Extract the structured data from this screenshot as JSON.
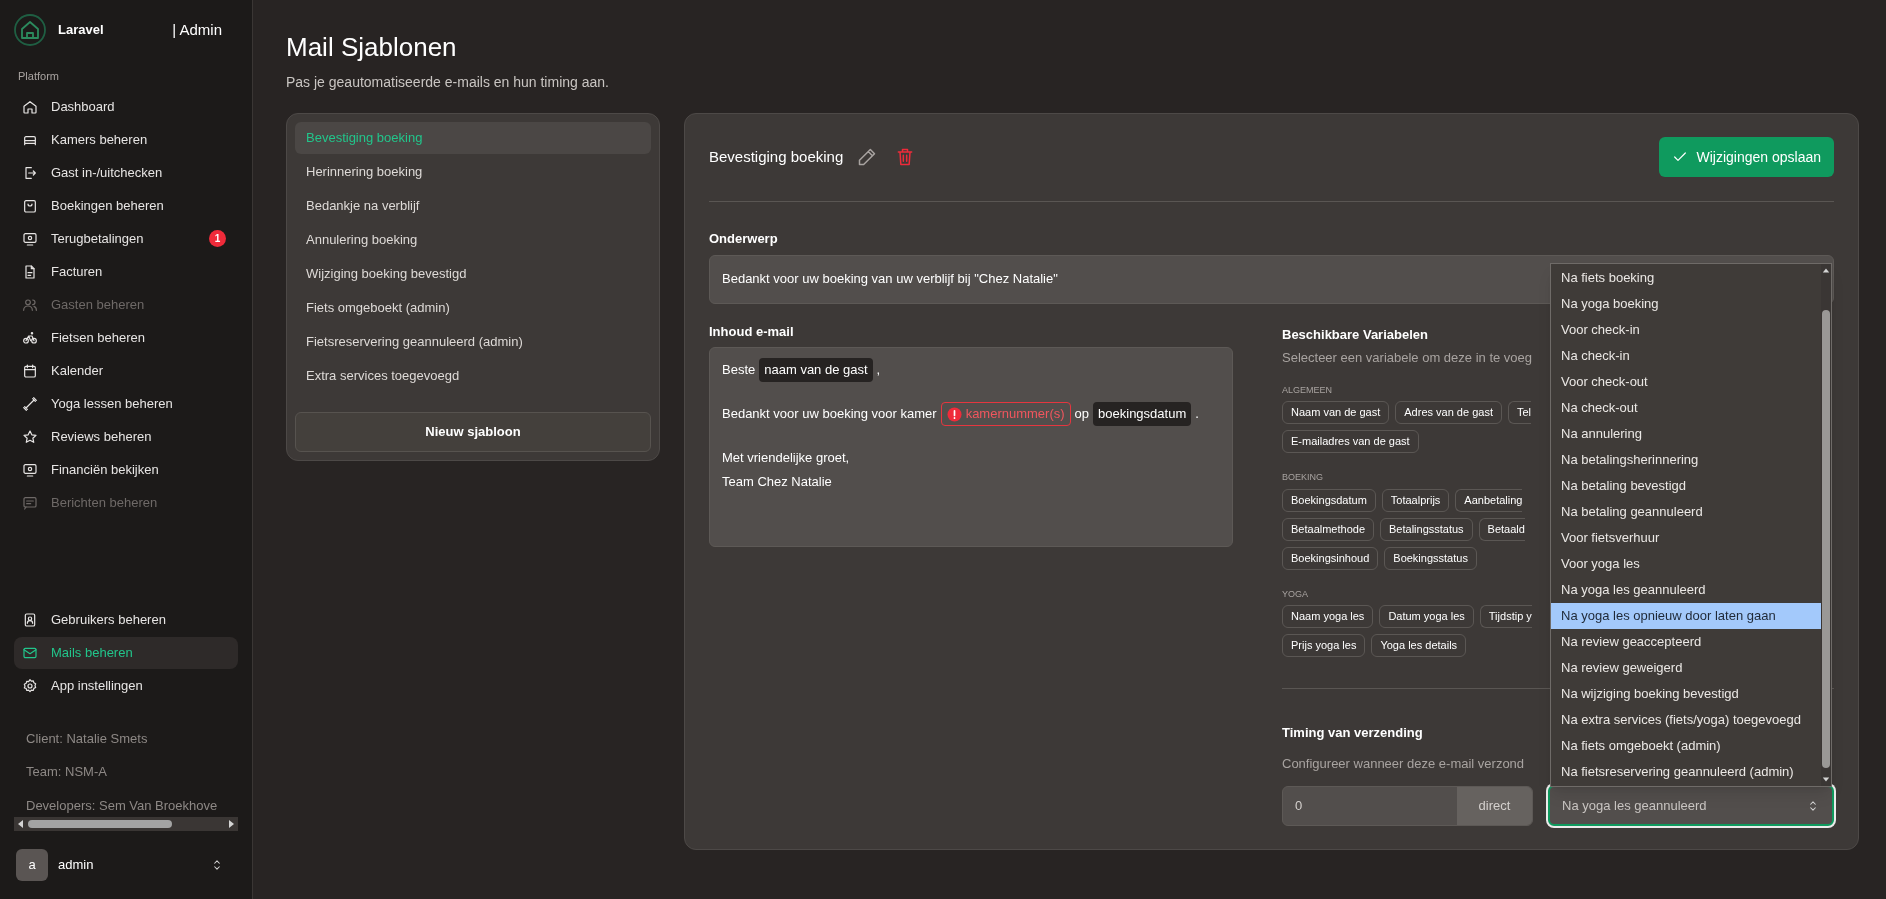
{
  "sidebar": {
    "brand": "Laravel",
    "brand_suffix": "| Admin",
    "section": "Platform",
    "items": [
      {
        "label": "Dashboard",
        "selected": false,
        "disabled": false
      },
      {
        "label": "Kamers beheren",
        "selected": false,
        "disabled": false
      },
      {
        "label": "Gast in-/uitchecken",
        "selected": false,
        "disabled": false
      },
      {
        "label": "Boekingen beheren",
        "selected": false,
        "disabled": false
      },
      {
        "label": "Terugbetalingen",
        "selected": false,
        "disabled": false,
        "badge": "1"
      },
      {
        "label": "Facturen",
        "selected": false,
        "disabled": false
      },
      {
        "label": "Gasten beheren",
        "selected": false,
        "disabled": true
      },
      {
        "label": "Fietsen beheren",
        "selected": false,
        "disabled": false
      },
      {
        "label": "Kalender",
        "selected": false,
        "disabled": false
      },
      {
        "label": "Yoga lessen beheren",
        "selected": false,
        "disabled": false
      },
      {
        "label": "Reviews beheren",
        "selected": false,
        "disabled": false
      },
      {
        "label": "Financiën bekijken",
        "selected": false,
        "disabled": false
      },
      {
        "label": "Berichten beheren",
        "selected": false,
        "disabled": true
      }
    ],
    "bottom_items": [
      {
        "label": "Gebruikers beheren",
        "selected": false,
        "disabled": false
      },
      {
        "label": "Mails beheren",
        "selected": true,
        "disabled": false
      },
      {
        "label": "App instellingen",
        "selected": false,
        "disabled": false
      }
    ],
    "info": [
      "Client: Natalie Smets",
      "Team: NSM-A",
      "Developers: Sem Van Broekhove"
    ],
    "user": {
      "avatar": "a",
      "name": "admin"
    }
  },
  "page": {
    "title": "Mail Sjablonen",
    "subtitle": "Pas je geautomatiseerde e-mails en hun timing aan."
  },
  "templates": {
    "items": [
      {
        "label": "Bevestiging boeking",
        "selected": true
      },
      {
        "label": "Herinnering boeking",
        "selected": false
      },
      {
        "label": "Bedankje na verblijf",
        "selected": false
      },
      {
        "label": "Annulering boeking",
        "selected": false
      },
      {
        "label": "Wijziging boeking bevestigd",
        "selected": false
      },
      {
        "label": "Fiets omgeboekt (admin)",
        "selected": false
      },
      {
        "label": "Fietsreservering geannuleerd (admin)",
        "selected": false
      },
      {
        "label": "Extra services toegevoegd",
        "selected": false
      }
    ],
    "new_button": "Nieuw sjabloon"
  },
  "editor": {
    "title": "Bevestiging boeking",
    "save_button": "Wijzigingen opslaan",
    "subject_label": "Onderwerp",
    "subject": "Bedankt voor uw boeking van uw verblijf bij \"Chez Natalie\"",
    "body_label": "Inhoud e-mail",
    "body": [
      [
        [
          {
            "kind": "text",
            "text": "Beste"
          },
          {
            "kind": "variable",
            "text": "naam van de gast"
          },
          {
            "kind": "text",
            "text": ","
          }
        ]
      ],
      [
        [
          {
            "kind": "text",
            "text": "Bedankt voor uw boeking voor kamer"
          },
          {
            "kind": "missing",
            "text": "kamernummer(s)"
          },
          {
            "kind": "text",
            "text": "op"
          },
          {
            "kind": "variable",
            "text": "boekingsdatum"
          },
          {
            "kind": "text",
            "text": "."
          }
        ]
      ],
      [
        [
          {
            "kind": "text",
            "text": "Met vriendelijke groet,"
          }
        ],
        [
          {
            "kind": "text",
            "text": "Team Chez Natalie"
          }
        ]
      ]
    ],
    "variables": {
      "title": "Beschikbare Variabelen",
      "description": "Selecteer een variabele om deze in te voeg",
      "groups": [
        {
          "label": "ALGEMEEN",
          "rows": [
            [
              {
                "text": "Naam van de gast",
                "truncated": false
              },
              {
                "text": "Adres van de gast",
                "truncated": false
              },
              {
                "text": "Tel",
                "truncated": true
              }
            ],
            [
              {
                "text": "E-mailadres van de gast",
                "truncated": false
              }
            ]
          ]
        },
        {
          "label": "BOEKING",
          "rows": [
            [
              {
                "text": "Boekingsdatum",
                "truncated": false
              },
              {
                "text": "Totaalprijs",
                "truncated": false
              },
              {
                "text": "Aanbetaling",
                "truncated": true
              }
            ],
            [
              {
                "text": "Betaalmethode",
                "truncated": false
              },
              {
                "text": "Betalingsstatus",
                "truncated": false
              },
              {
                "text": "Betaald",
                "truncated": true
              }
            ],
            [
              {
                "text": "Boekingsinhoud",
                "truncated": false
              },
              {
                "text": "Boekingsstatus",
                "truncated": false
              }
            ]
          ]
        },
        {
          "label": "YOGA",
          "rows": [
            [
              {
                "text": "Naam yoga les",
                "truncated": false
              },
              {
                "text": "Datum yoga les",
                "truncated": false
              },
              {
                "text": "Tijdstip y",
                "truncated": true
              }
            ],
            [
              {
                "text": "Prijs yoga les",
                "truncated": false
              },
              {
                "text": "Yoga les details",
                "truncated": false
              }
            ]
          ]
        }
      ]
    },
    "timing": {
      "title": "Timing van verzending",
      "description": "Configureer wanneer deze e-mail verzond",
      "amount": "0",
      "unit": "direct",
      "trigger": "Na yoga les geannuleerd"
    },
    "trigger_dropdown": {
      "options": [
        {
          "label": "Na fiets boeking",
          "selected": false
        },
        {
          "label": "Na yoga boeking",
          "selected": false
        },
        {
          "label": "Voor check-in",
          "selected": false
        },
        {
          "label": "Na check-in",
          "selected": false
        },
        {
          "label": "Voor check-out",
          "selected": false
        },
        {
          "label": "Na check-out",
          "selected": false
        },
        {
          "label": "Na annulering",
          "selected": false
        },
        {
          "label": "Na betalingsherinnering",
          "selected": false
        },
        {
          "label": "Na betaling bevestigd",
          "selected": false
        },
        {
          "label": "Na betaling geannuleerd",
          "selected": false
        },
        {
          "label": "Voor fietsverhuur",
          "selected": false
        },
        {
          "label": "Voor yoga les",
          "selected": false
        },
        {
          "label": "Na yoga les geannuleerd",
          "selected": false
        },
        {
          "label": "Na yoga les opnieuw door laten gaan",
          "selected": true
        },
        {
          "label": "Na review geaccepteerd",
          "selected": false
        },
        {
          "label": "Na review geweigerd",
          "selected": false
        },
        {
          "label": "Na wijziging boeking bevestigd",
          "selected": false
        },
        {
          "label": "Na extra services (fiets/yoga) toegevoegd",
          "selected": false
        },
        {
          "label": "Na fiets omgeboekt (admin)",
          "selected": false
        },
        {
          "label": "Na fietsreservering geannuleerd (admin)",
          "selected": false
        }
      ]
    }
  }
}
